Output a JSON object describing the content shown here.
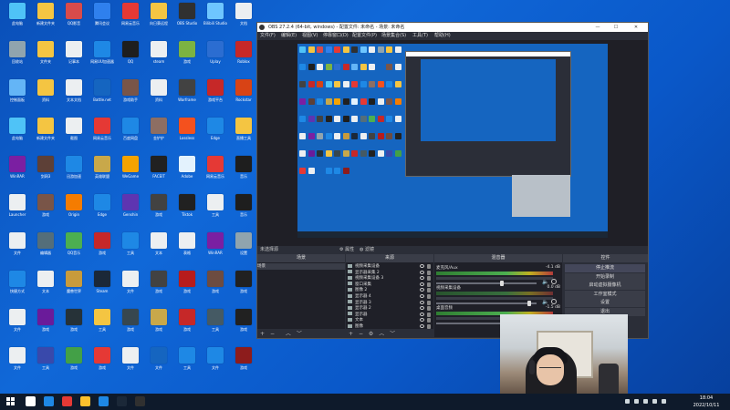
{
  "desktop": {
    "icons": [
      {
        "label": "此电脑",
        "color": "#4fc3f7"
      },
      {
        "label": "新建文件夹",
        "color": "#f4c542"
      },
      {
        "label": "QQ影音",
        "color": "#d84b4b"
      },
      {
        "label": "腾讯会议",
        "color": "#2f80ed"
      },
      {
        "label": "网易云音乐",
        "color": "#e53935"
      },
      {
        "label": "向日葵远程",
        "color": "#f4c542"
      },
      {
        "label": "OBS Studio",
        "color": "#303030"
      },
      {
        "label": "Bilibili Studio",
        "color": "#6ec6ff"
      },
      {
        "label": "文档",
        "color": "#eceff1"
      },
      {
        "label": "回收站",
        "color": "#90a4ae"
      },
      {
        "label": "文件夹",
        "color": "#f4c542"
      },
      {
        "label": "记事本",
        "color": "#eceff1"
      },
      {
        "label": "网易UU加速器",
        "color": "#1e88e5"
      },
      {
        "label": "QQ",
        "color": "#1e1e1e"
      },
      {
        "label": "steam",
        "color": "#eceff1"
      },
      {
        "label": "游戏",
        "color": "#7cb342"
      },
      {
        "label": "Uplay",
        "color": "#2b6dd1"
      },
      {
        "label": "Roblox",
        "color": "#c62828"
      },
      {
        "label": "控制面板",
        "color": "#64b5f6"
      },
      {
        "label": "资料",
        "color": "#f4c542"
      },
      {
        "label": "文本文档",
        "color": "#eceff1"
      },
      {
        "label": "Battle.net",
        "color": "#1565c0"
      },
      {
        "label": "游戏助手",
        "color": "#795548"
      },
      {
        "label": "资料",
        "color": "#eceff1"
      },
      {
        "label": "Warframe",
        "color": "#424242"
      },
      {
        "label": "游戏平台",
        "color": "#c62828"
      },
      {
        "label": "Rockstar",
        "color": "#d84315"
      },
      {
        "label": "此电脑",
        "color": "#4fc3f7"
      },
      {
        "label": "新建文件夹",
        "color": "#f4c542"
      },
      {
        "label": "截图",
        "color": "#eceff1"
      },
      {
        "label": "网易云音乐",
        "color": "#e53935"
      },
      {
        "label": "百度网盘",
        "color": "#1e88e5"
      },
      {
        "label": "金铲铲",
        "color": "#8d6e63"
      },
      {
        "label": "Lossless",
        "color": "#f4511e"
      },
      {
        "label": "Edge",
        "color": "#1e88e5"
      },
      {
        "label": "直播工具",
        "color": "#f4c542"
      },
      {
        "label": "WinRAR",
        "color": "#7b1fa2"
      },
      {
        "label": "剑网3",
        "color": "#5d4037"
      },
      {
        "label": "迅游加速",
        "color": "#1e88e5"
      },
      {
        "label": "英雄联盟",
        "color": "#c8a84a"
      },
      {
        "label": "WeGame",
        "color": "#f4a300"
      },
      {
        "label": "FACEIT",
        "color": "#212121"
      },
      {
        "label": "Adobe",
        "color": "#e3f2fd"
      },
      {
        "label": "网易云音乐",
        "color": "#e53935"
      },
      {
        "label": "音乐",
        "color": "#1e1e1e"
      },
      {
        "label": "Launcher",
        "color": "#eceff1"
      },
      {
        "label": "游戏",
        "color": "#795548"
      },
      {
        "label": "Origin",
        "color": "#f57c00"
      },
      {
        "label": "Edge",
        "color": "#1e88e5"
      },
      {
        "label": "Genshin",
        "color": "#5e35b1"
      },
      {
        "label": "游戏",
        "color": "#424242"
      },
      {
        "label": "Tiktok",
        "color": "#212121"
      },
      {
        "label": "工具",
        "color": "#eceff1"
      },
      {
        "label": "音乐",
        "color": "#1e1e1e"
      },
      {
        "label": "文件",
        "color": "#eceff1"
      },
      {
        "label": "编辑器",
        "color": "#546e7a"
      },
      {
        "label": "QQ音乐",
        "color": "#4caf50"
      },
      {
        "label": "游戏",
        "color": "#c62828"
      },
      {
        "label": "工具",
        "color": "#1e88e5"
      },
      {
        "label": "文本",
        "color": "#eceff1"
      },
      {
        "label": "表格",
        "color": "#eceff1"
      },
      {
        "label": "WinRAR",
        "color": "#7b1fa2"
      },
      {
        "label": "设置",
        "color": "#90a4ae"
      },
      {
        "label": "快捷方式",
        "color": "#1e88e5"
      },
      {
        "label": "文本",
        "color": "#eceff1"
      },
      {
        "label": "魔兽世界",
        "color": "#c89b3c"
      },
      {
        "label": "Steam",
        "color": "#1b2838"
      },
      {
        "label": "文件",
        "color": "#eceff1"
      },
      {
        "label": "游戏",
        "color": "#424242"
      },
      {
        "label": "游戏",
        "color": "#b71c1c"
      },
      {
        "label": "游戏",
        "color": "#6d4c41"
      },
      {
        "label": "游戏",
        "color": "#212121"
      },
      {
        "label": "文件",
        "color": "#eceff1"
      },
      {
        "label": "游戏",
        "color": "#6a1b9a"
      },
      {
        "label": "游戏",
        "color": "#263238"
      },
      {
        "label": "工具",
        "color": "#f4c542"
      },
      {
        "label": "游戏",
        "color": "#37474f"
      },
      {
        "label": "游戏",
        "color": "#c8a84a"
      },
      {
        "label": "游戏",
        "color": "#c62828"
      },
      {
        "label": "工具",
        "color": "#455a64"
      },
      {
        "label": "游戏",
        "color": "#212121"
      },
      {
        "label": "文件",
        "color": "#eceff1"
      },
      {
        "label": "工具",
        "color": "#3949ab"
      },
      {
        "label": "游戏",
        "color": "#43a047"
      },
      {
        "label": "游戏",
        "color": "#e53935"
      },
      {
        "label": "文件",
        "color": "#eceff1"
      },
      {
        "label": "文件",
        "color": "#1565c0"
      },
      {
        "label": "工具",
        "color": "#1e88e5"
      },
      {
        "label": "文件",
        "color": "#1e88e5"
      },
      {
        "label": "游戏",
        "color": "#8d1c1c"
      }
    ]
  },
  "obs": {
    "title": "OBS 27.2.4 (64-bit, windows) - 配置文件: 未命名 - 场景: 未命名",
    "window_buttons": [
      "—",
      "☐",
      "✕"
    ],
    "menu": [
      "文件(F)",
      "编辑(E)",
      "视图(V)",
      "停靠窗口(D)",
      "配置文件(P)",
      "场景集合(S)",
      "工具(T)",
      "帮助(H)"
    ],
    "subbar": {
      "left": "未选择源",
      "btn1": "属性",
      "btn2": "滤镜"
    },
    "scenes": {
      "title": "场景",
      "items": [
        "场景"
      ]
    },
    "sources": {
      "title": "来源",
      "items": [
        "视频采集设备",
        "显示器采集 2",
        "视频采集设备 3",
        "窗口采集",
        "图像 2",
        "显示器 4",
        "显示器 3",
        "显示器 2",
        "显示器",
        "文本",
        "图像"
      ]
    },
    "mixer": {
      "title": "混音器",
      "channels": [
        {
          "name": "麦克风/Aux",
          "db": "-4.1 dB"
        },
        {
          "name": "视频采集设备",
          "db": "0.0 dB"
        },
        {
          "name": "桌面音频",
          "db": "-1.5 dB"
        }
      ]
    },
    "controls": {
      "title": "控件",
      "buttons": [
        "停止推流",
        "开始录制",
        "启动虚拟摄像机",
        "工作室模式",
        "设置",
        "退出"
      ]
    },
    "status": "LIVE: 00:12:35   REC: 00:00:00   CPU: 12.0%, 30.00 fps"
  },
  "taskbar": {
    "time": "18:04",
    "date": "2022/10/11",
    "apps": [
      {
        "name": "search",
        "color": "#ffffff"
      },
      {
        "name": "edge",
        "color": "#1e88e5"
      },
      {
        "name": "netease",
        "color": "#e53935"
      },
      {
        "name": "chrome",
        "color": "#fbc02d"
      },
      {
        "name": "qq",
        "color": "#1e88e5"
      },
      {
        "name": "steam",
        "color": "#1b2838"
      },
      {
        "name": "obs",
        "color": "#303030"
      }
    ]
  }
}
